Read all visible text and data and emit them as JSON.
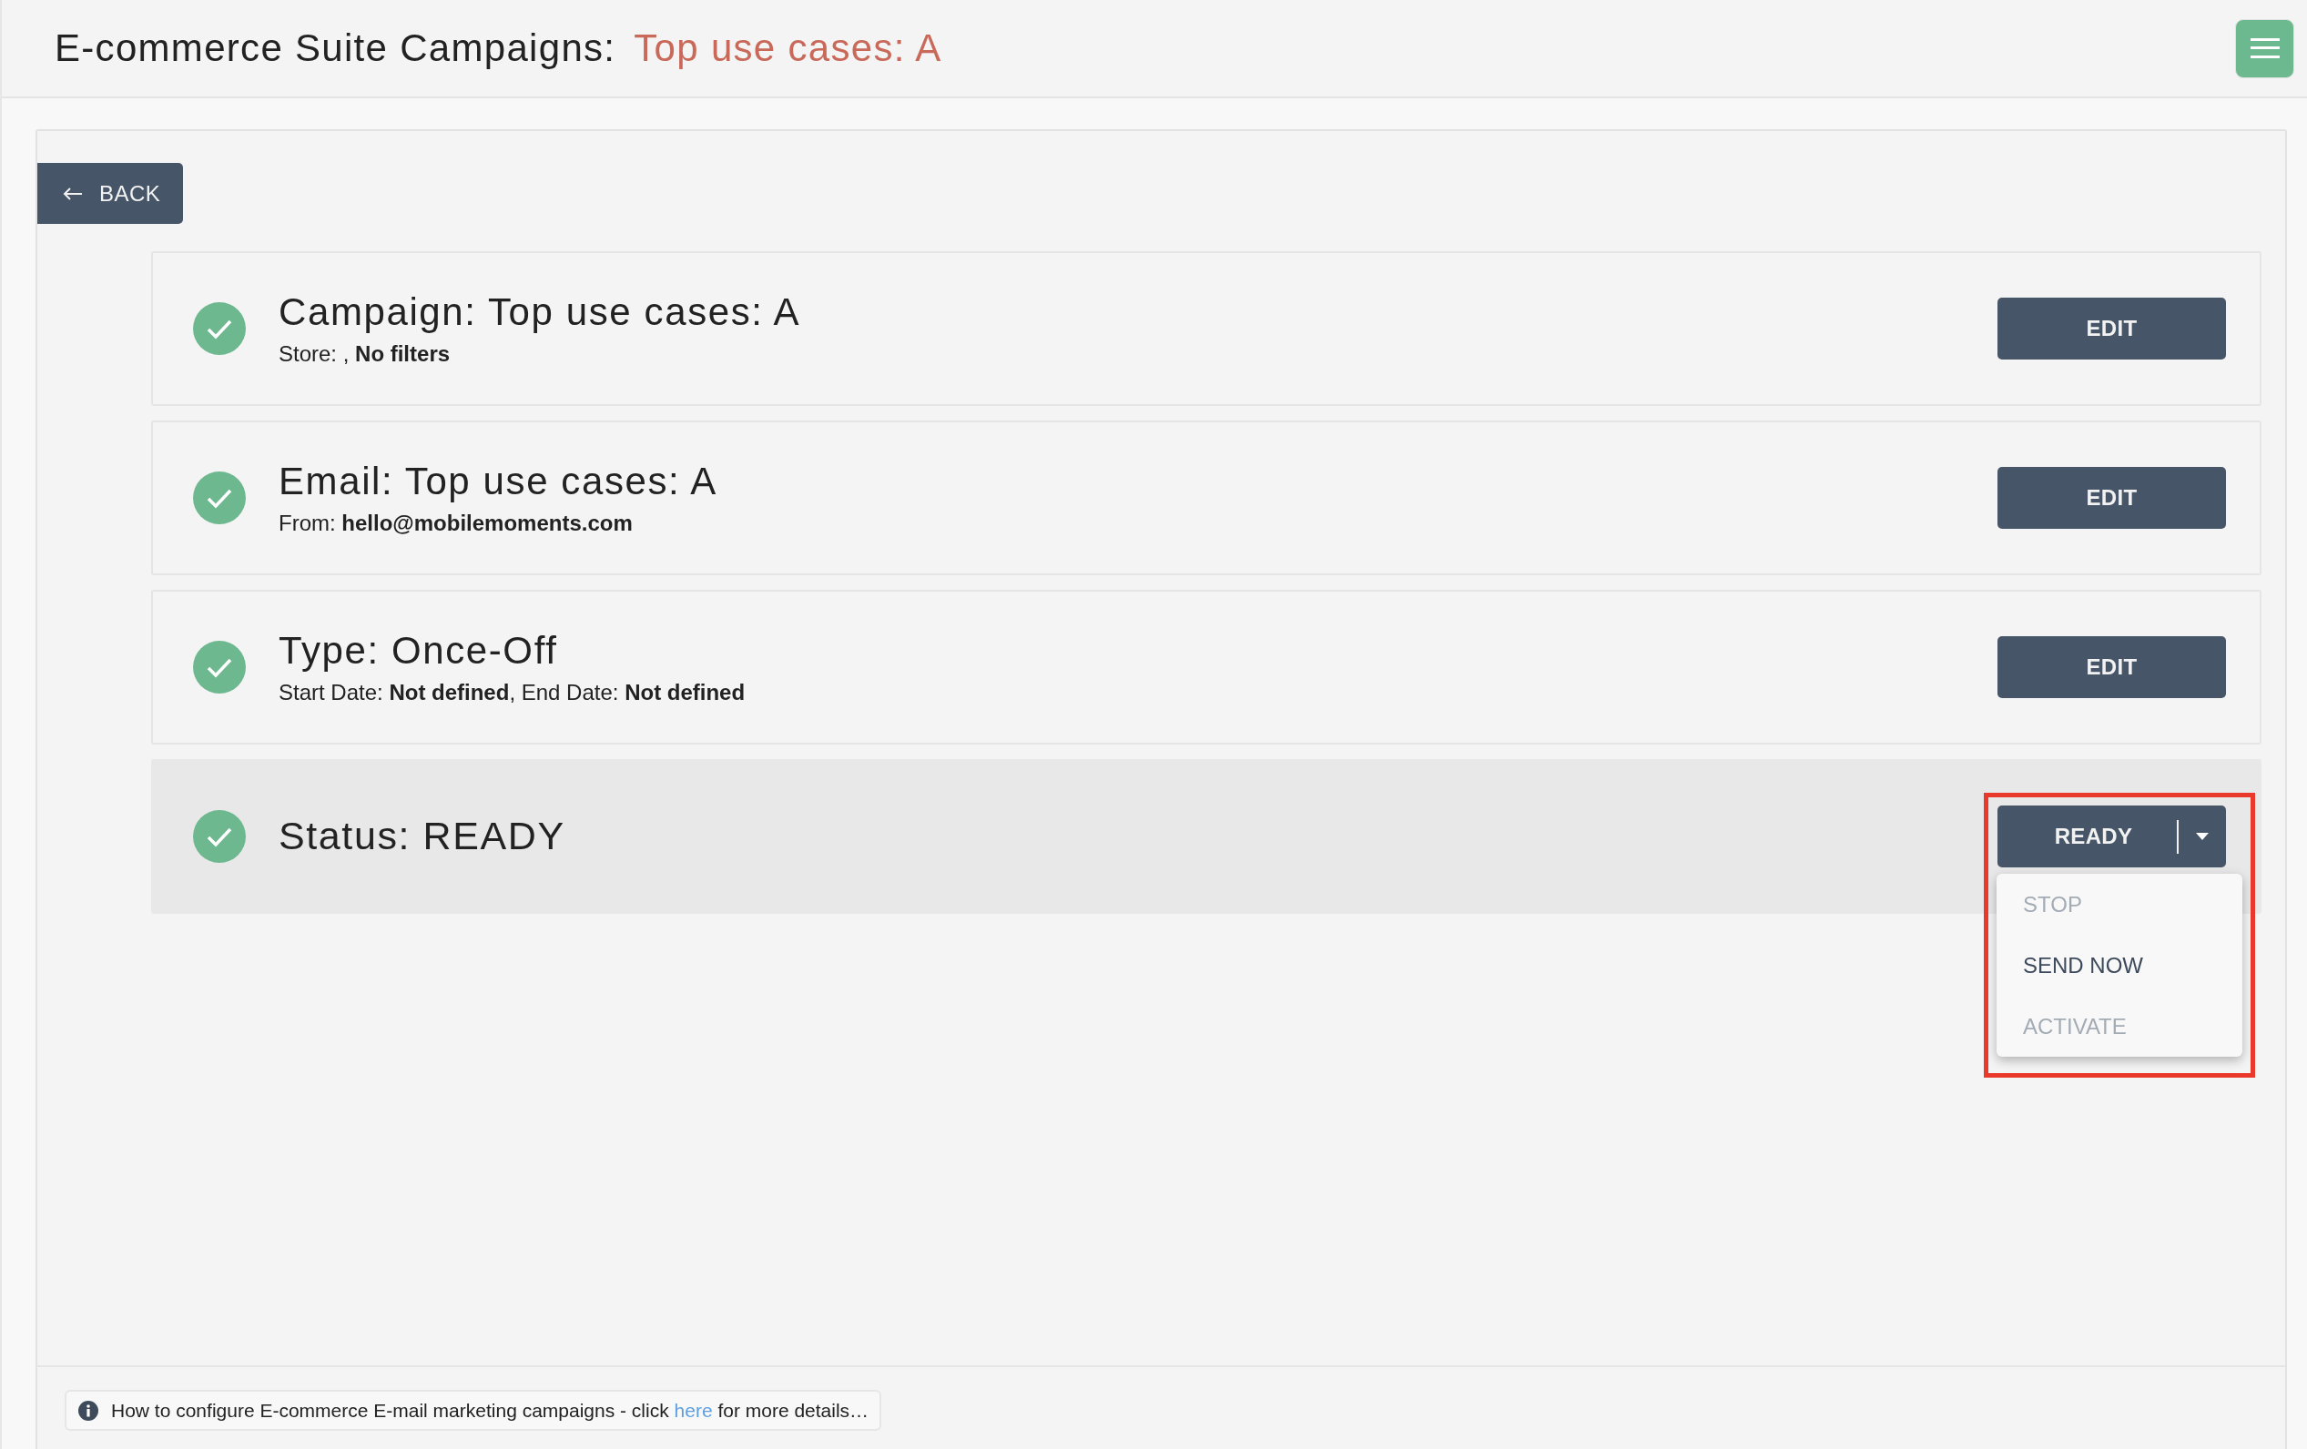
{
  "header": {
    "title": "E-commerce Suite Campaigns:",
    "subtitle": "Top use cases: A"
  },
  "back_button": {
    "label": "BACK"
  },
  "steps": [
    {
      "kind": "summary",
      "complete": true,
      "selected": false,
      "title": "Campaign: Top use cases: A",
      "detail": "Store: , **No filters**",
      "action": "EDIT"
    },
    {
      "kind": "summary",
      "complete": true,
      "selected": false,
      "title": "Email: Top use cases: A",
      "detail": "From: **hello@mobilemoments.com**",
      "action": "EDIT"
    },
    {
      "kind": "summary",
      "complete": true,
      "selected": false,
      "title": "Type: Once-Off",
      "detail": "Start Date: **Not defined**, End Date: **Not defined**",
      "action": "EDIT"
    },
    {
      "kind": "status",
      "complete": true,
      "selected": true,
      "title": "Status: READY",
      "action": "READY",
      "highlighted": true,
      "menu": [
        {
          "label": "STOP",
          "disabled": true
        },
        {
          "label": "SEND NOW",
          "disabled": false
        },
        {
          "label": "ACTIVATE",
          "disabled": true
        }
      ]
    }
  ],
  "footer": {
    "before": "How to configure E-commerce E-mail marketing campaigns - click ",
    "link": "here",
    "after": " for more details…"
  }
}
